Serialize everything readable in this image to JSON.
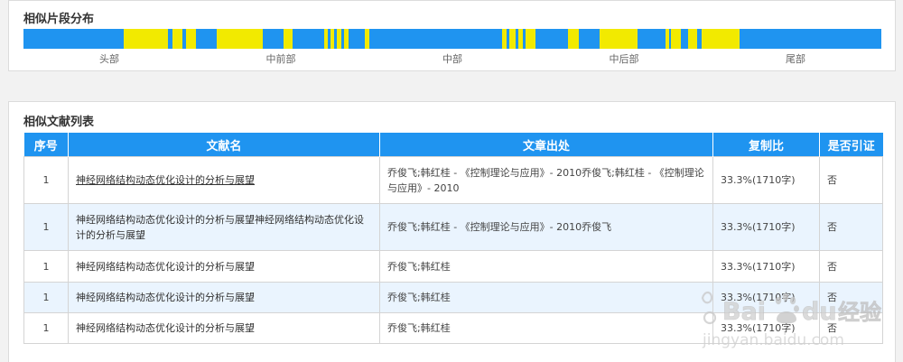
{
  "distribution": {
    "title": "相似片段分布",
    "segments": [
      {
        "start": 0.117,
        "end": 0.168
      },
      {
        "start": 0.174,
        "end": 0.185
      },
      {
        "start": 0.189,
        "end": 0.201
      },
      {
        "start": 0.225,
        "end": 0.279
      },
      {
        "start": 0.303,
        "end": 0.314
      },
      {
        "start": 0.351,
        "end": 0.355
      },
      {
        "start": 0.358,
        "end": 0.362
      },
      {
        "start": 0.365,
        "end": 0.37
      },
      {
        "start": 0.374,
        "end": 0.379
      },
      {
        "start": 0.398,
        "end": 0.403
      },
      {
        "start": 0.558,
        "end": 0.563
      },
      {
        "start": 0.566,
        "end": 0.574
      },
      {
        "start": 0.577,
        "end": 0.582
      },
      {
        "start": 0.585,
        "end": 0.597
      },
      {
        "start": 0.635,
        "end": 0.647
      },
      {
        "start": 0.672,
        "end": 0.716
      },
      {
        "start": 0.748,
        "end": 0.753
      },
      {
        "start": 0.755,
        "end": 0.766
      },
      {
        "start": 0.775,
        "end": 0.785
      },
      {
        "start": 0.79,
        "end": 0.835
      }
    ],
    "labels": [
      {
        "text": "头部",
        "pos": 0.1
      },
      {
        "text": "中前部",
        "pos": 0.3
      },
      {
        "text": "中部",
        "pos": 0.5
      },
      {
        "text": "中后部",
        "pos": 0.7
      },
      {
        "text": "尾部",
        "pos": 0.9
      }
    ]
  },
  "list": {
    "title": "相似文献列表",
    "headers": {
      "no": "序号",
      "name": "文献名",
      "source": "文章出处",
      "ratio": "复制比",
      "cited": "是否引证"
    },
    "rows": [
      {
        "no": "1",
        "name": "神经网络结构动态优化设计的分析与展望",
        "source": "乔俊飞;韩红桂 - 《控制理论与应用》- 2010乔俊飞;韩红桂 - 《控制理论与应用》- 2010",
        "ratio": "33.3%(1710字)",
        "cited": "否"
      },
      {
        "no": "1",
        "name": "神经网络结构动态优化设计的分析与展望神经网络结构动态优化设计的分析与展望",
        "source": "乔俊飞;韩红桂 - 《控制理论与应用》- 2010乔俊飞",
        "ratio": "33.3%(1710字)",
        "cited": "否"
      },
      {
        "no": "1",
        "name": "神经网络结构动态优化设计的分析与展望",
        "source": "乔俊飞;韩红桂",
        "ratio": "33.3%(1710字)",
        "cited": "否"
      },
      {
        "no": "1",
        "name": "神经网络结构动态优化设计的分析与展望",
        "source": "乔俊飞;韩红桂",
        "ratio": "33.3%(1710字)",
        "cited": "否"
      },
      {
        "no": "1",
        "name": "神经网络结构动态优化设计的分析与展望",
        "source": "乔俊飞;韩红桂",
        "ratio": "33.3%(1710字)",
        "cited": "否"
      }
    ]
  },
  "watermark": {
    "brand": "Bai du 经验",
    "url": "jingyan.baidu.com"
  },
  "colors": {
    "bar_blue": "#1f94f0",
    "highlight_yellow": "#f2ea00",
    "row_alt": "#eaf4fe"
  }
}
